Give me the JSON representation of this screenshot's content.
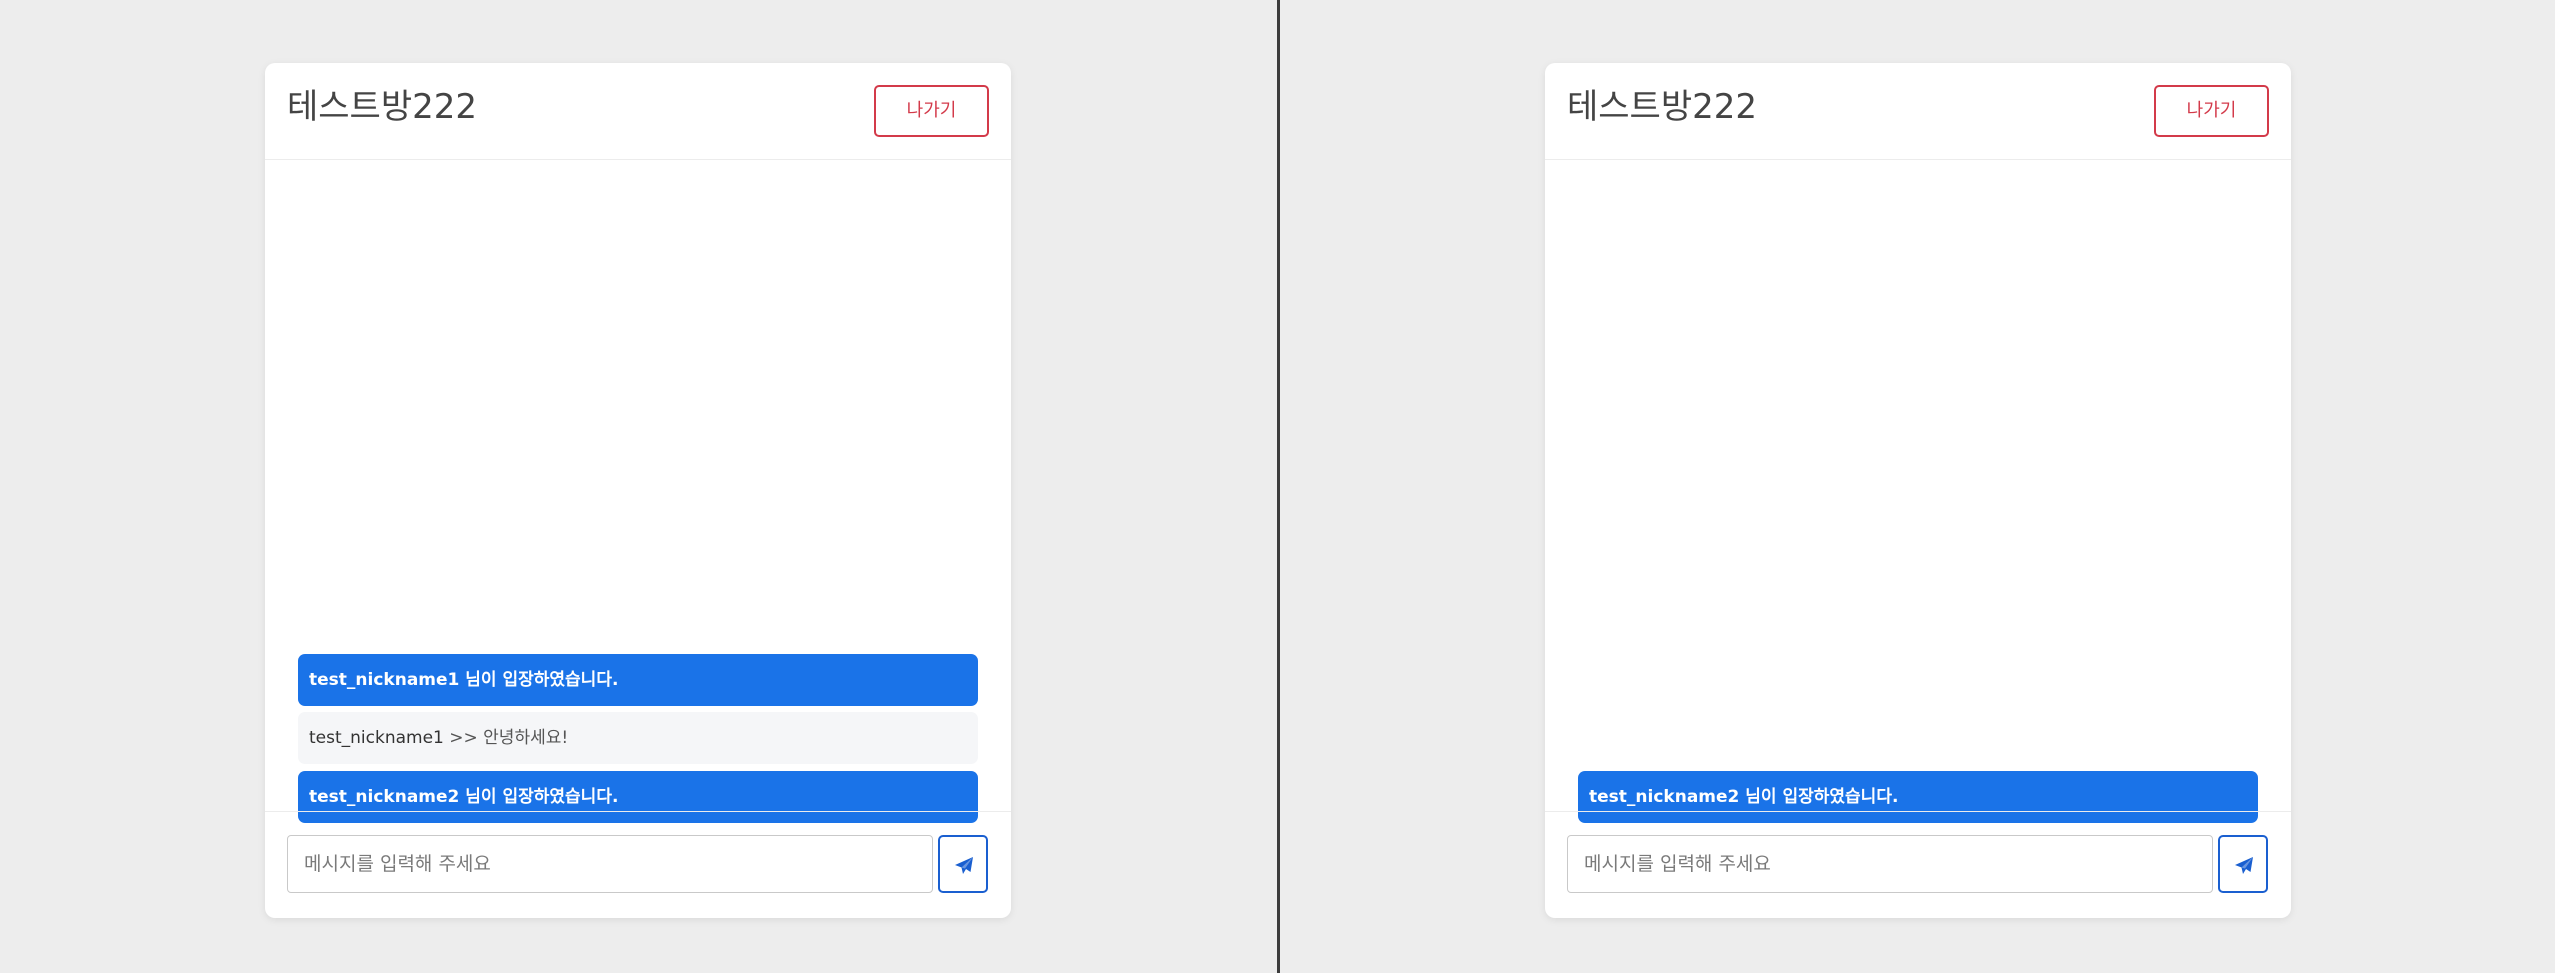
{
  "colors": {
    "background": "#ededed",
    "card": "#ffffff",
    "system_message": "#1a73e8",
    "chat_message": "#f5f6f8",
    "leave_button": "#d33a4a",
    "send_button": "#1a5fd0",
    "divider": "#3c3c3c"
  },
  "left": {
    "room_title": "테스트방222",
    "leave_label": "나가기",
    "messages": [
      {
        "type": "system",
        "text": "test_nickname1 님이 입장하였습니다."
      },
      {
        "type": "chat",
        "nickname": "test_nickname1",
        "separator": " >> ",
        "text": "안녕하세요!"
      },
      {
        "type": "system",
        "text": "test_nickname2 님이 입장하였습니다."
      }
    ],
    "input": {
      "placeholder": "메시지를 입력해 주세요",
      "value": ""
    },
    "send_icon": "paper-plane-icon"
  },
  "right": {
    "room_title": "테스트방222",
    "leave_label": "나가기",
    "messages": [
      {
        "type": "system",
        "text": "test_nickname2 님이 입장하였습니다."
      }
    ],
    "input": {
      "placeholder": "메시지를 입력해 주세요",
      "value": ""
    },
    "send_icon": "paper-plane-icon"
  }
}
